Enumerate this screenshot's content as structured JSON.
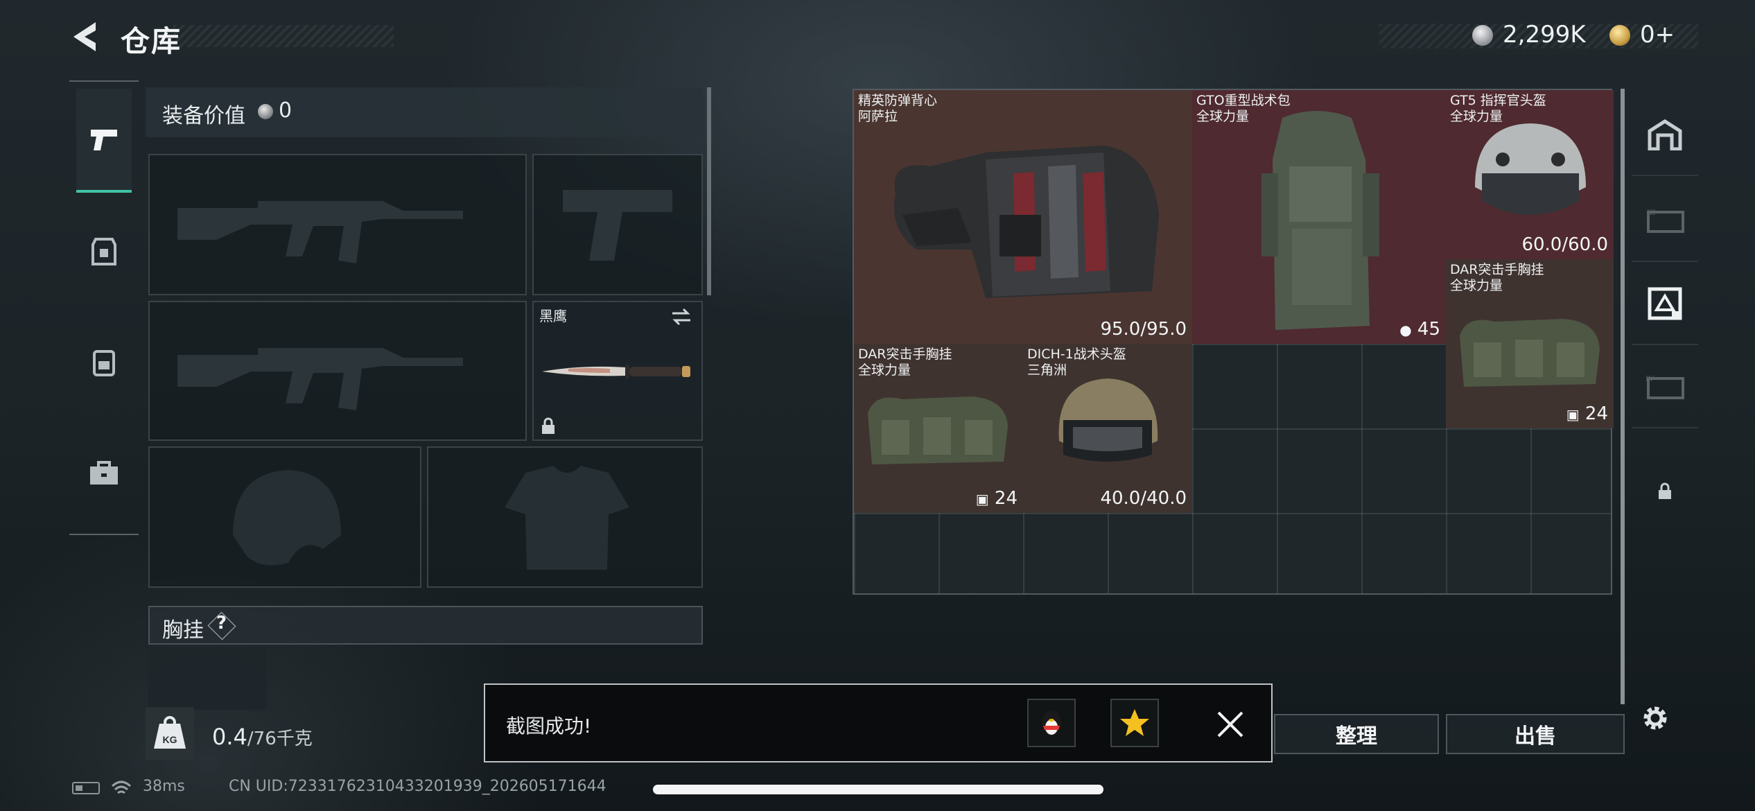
{
  "header": {
    "title": "仓库",
    "currency_1": "2,299K",
    "currency_2": "0+"
  },
  "equipment": {
    "label": "装备价值",
    "value": "0",
    "knife_name": "黑鹰",
    "chest_label": "胸挂",
    "chest_help": "?",
    "weight_current": "0.4",
    "weight_max": "/76千克",
    "weight_icon_text": "KG"
  },
  "inventory": {
    "items": [
      {
        "name": "精英防弹背心",
        "brand": "阿萨拉",
        "durability": "95.0/95.0"
      },
      {
        "name": "GTO重型战术包",
        "brand": "全球力量",
        "capacity": "45"
      },
      {
        "name": "GT5 指挥官头盔",
        "brand": "全球力量",
        "durability": "60.0/60.0"
      },
      {
        "name": "DAR突击手胸挂",
        "brand": "全球力量",
        "capacity": "24"
      },
      {
        "name": "DAR突击手胸挂",
        "brand": "全球力量",
        "capacity": "24"
      },
      {
        "name": "DICH-1战术头盔",
        "brand": "三角洲",
        "durability": "40.0/40.0"
      }
    ]
  },
  "buttons": {
    "sort": "整理",
    "sell": "出售"
  },
  "toast": {
    "message": "截图成功!"
  },
  "status": {
    "ping": "38ms",
    "uid": "CN UID:72331762310433201939_202605171644"
  }
}
